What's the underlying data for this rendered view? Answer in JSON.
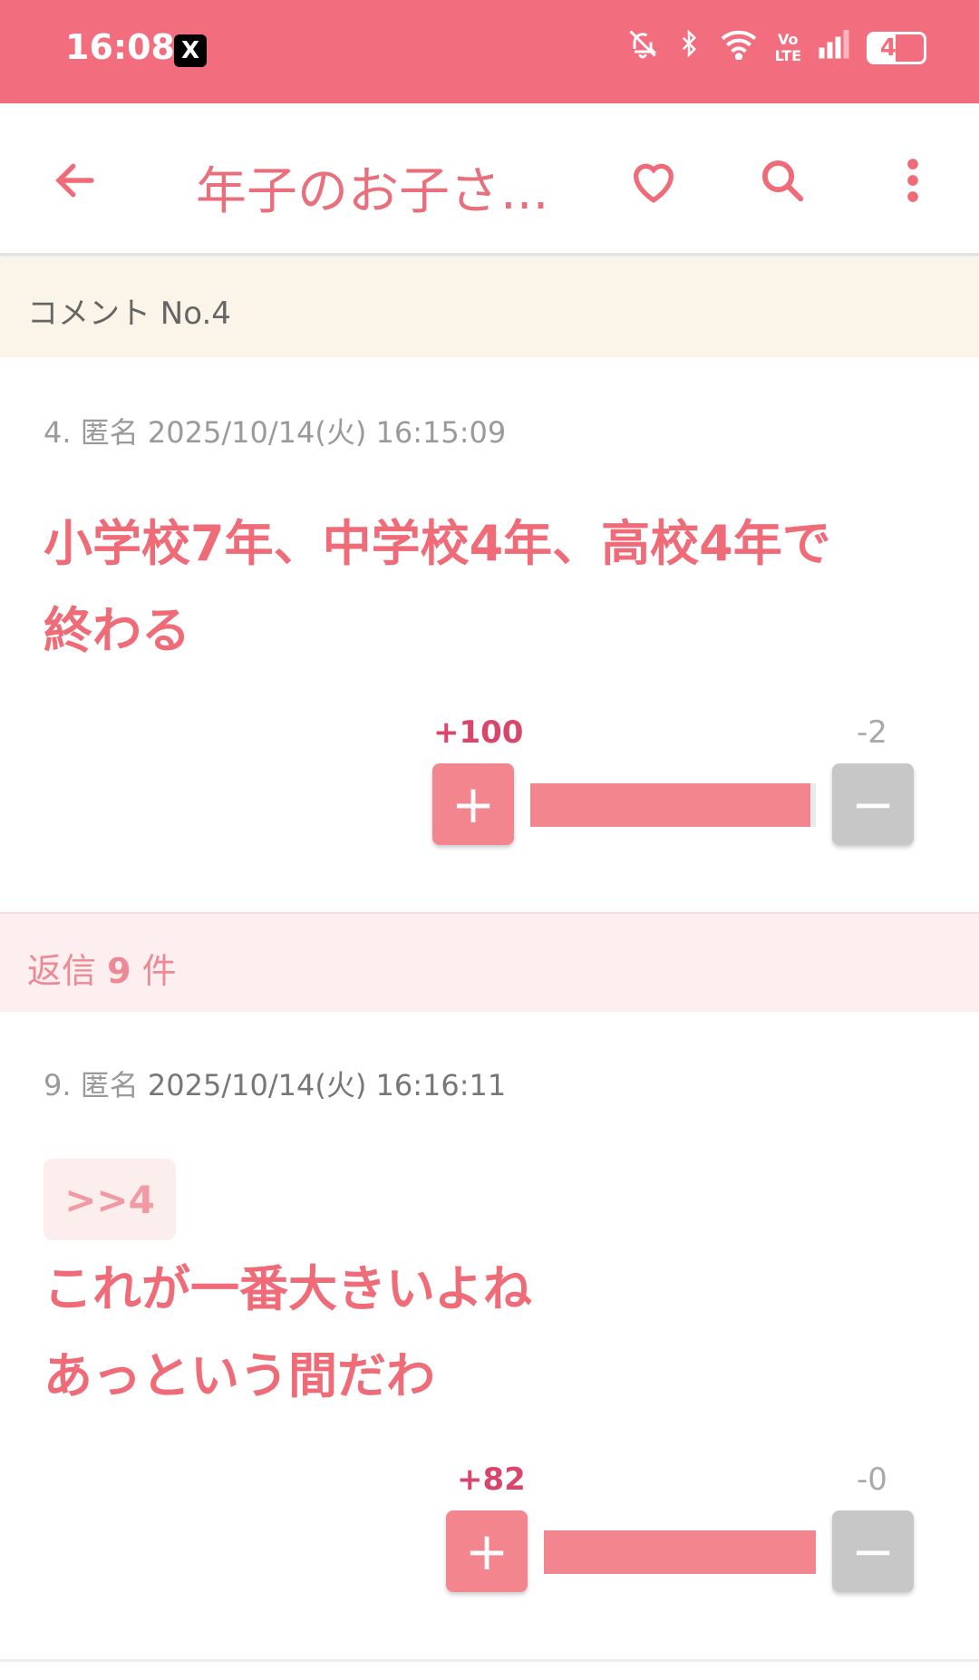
{
  "status_bar": {
    "time": "16:08",
    "app_badge": "X",
    "volte": "Vo\nLTE",
    "battery": "49",
    "battery_level": 0.49
  },
  "app_bar": {
    "title": "年子のお子さ...",
    "icons": [
      "back-arrow-icon",
      "heart-icon",
      "search-icon",
      "more-vertical-icon"
    ],
    "accent_color": "#f26d7d"
  },
  "comment_header": {
    "label": "コメント No.4"
  },
  "main_post": {
    "number_name": "4. 匿名",
    "date": "2025/10/14(火) 16:15:09",
    "lines": [
      "小学校7年、中学校4年、高校4年で",
      "終わる"
    ],
    "plus_count": "+100",
    "minus_count": "-2",
    "plus_ratio": 0.98
  },
  "replies": {
    "prefix": "返信",
    "count": "9",
    "suffix": "件"
  },
  "reply_post": {
    "number_name": "9. 匿名",
    "date": "2025/10/14(火) 16:16:11",
    "quote": ">>4",
    "lines": [
      "これが一番大きいよね",
      "あっという間だわ"
    ],
    "plus_count": "+82",
    "minus_count": "-0",
    "plus_ratio": 1.0
  }
}
